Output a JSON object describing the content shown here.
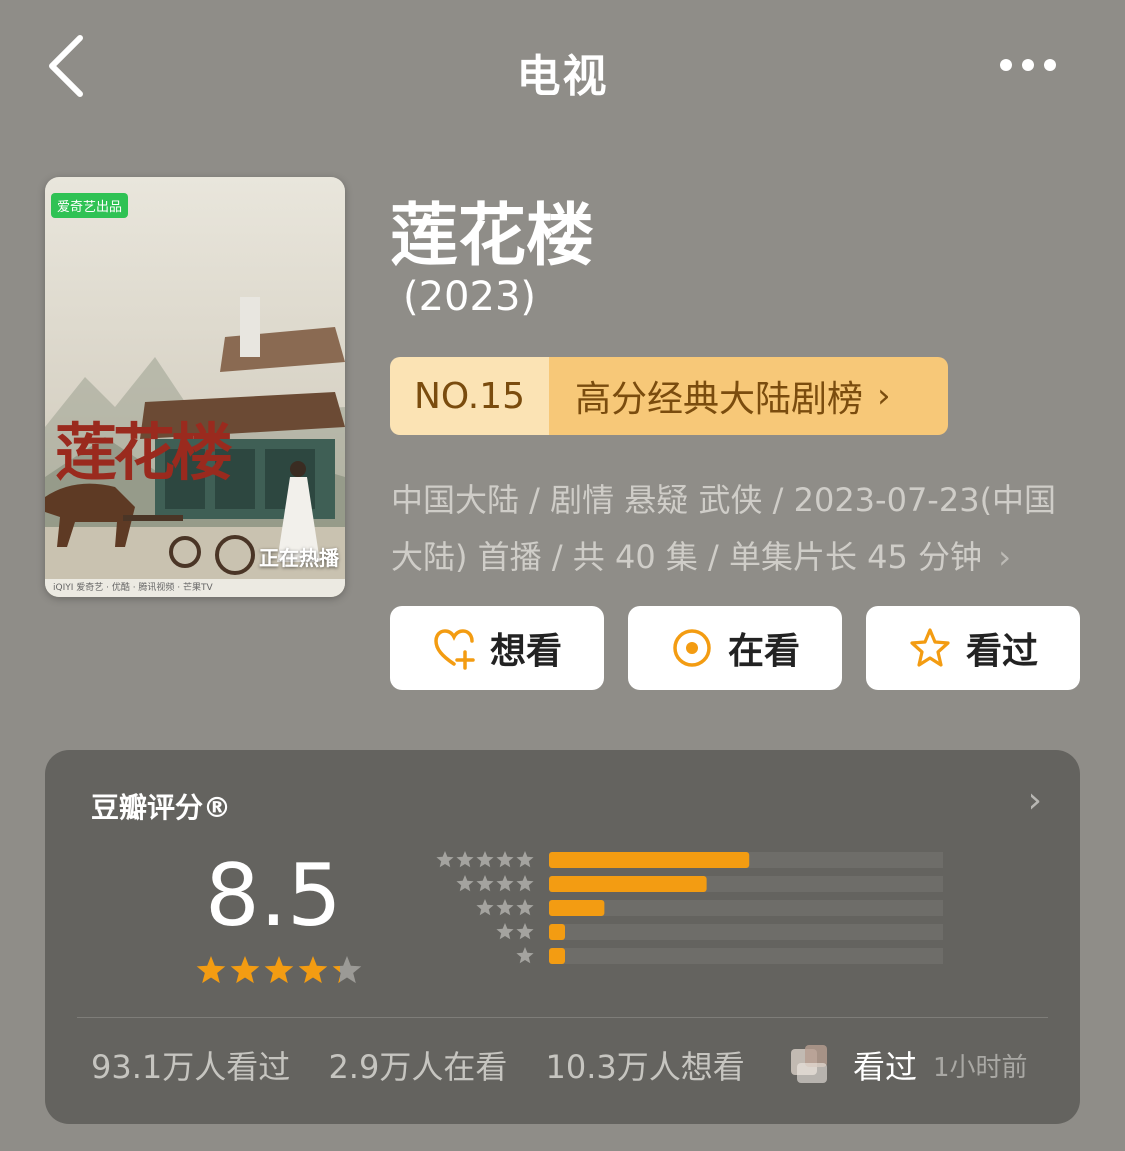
{
  "nav": {
    "title": "电视"
  },
  "poster": {
    "badge": "爱奇艺出品",
    "title": "莲花楼",
    "hot_label": "正在热播",
    "footer_text": "iQIYI 爱奇艺 · 优酷 · 腾讯视频 · 芒果TV"
  },
  "show": {
    "title": "莲花楼",
    "year": "(2023)",
    "rank_no": "NO.15",
    "rank_name": "高分经典大陆剧榜",
    "meta_line1": "中国大陆 / 剧情 悬疑 武侠 / 2023-07-23(中国",
    "meta_line2": "大陆) 首播 / 共 40 集 / 单集片长 45 分钟"
  },
  "actions": {
    "want": "想看",
    "watching": "在看",
    "watched": "看过"
  },
  "rating": {
    "label": "豆瓣评分®",
    "score": "8.5",
    "star_value": 4.25,
    "distribution": [
      {
        "stars": 5,
        "fraction": 0.47
      },
      {
        "stars": 4,
        "fraction": 0.37
      },
      {
        "stars": 3,
        "fraction": 0.13
      },
      {
        "stars": 2,
        "fraction": 0.03
      },
      {
        "stars": 1,
        "fraction": 0.03
      }
    ],
    "watched_count": "93.1万人看过",
    "watching_count": "2.9万人在看",
    "want_count": "10.3万人想看",
    "friend_status": "看过",
    "friend_time": "1小时前"
  },
  "colors": {
    "background": "#8f8d88",
    "card": "#64635f",
    "accent_orange": "#f39c12",
    "rank_light": "#fbe3b4",
    "rank_dark": "#f7c878"
  }
}
